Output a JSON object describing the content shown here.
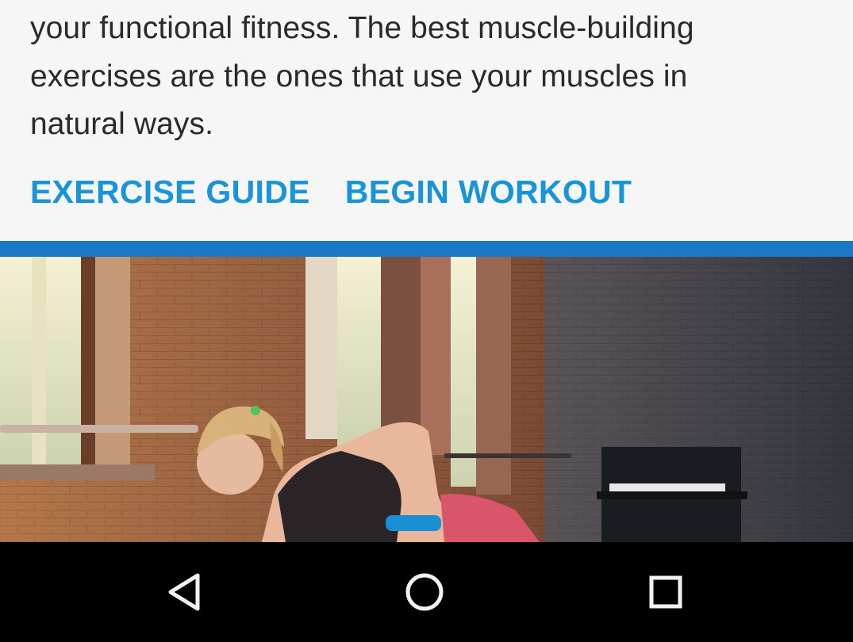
{
  "card": {
    "description_lines": [
      "your functional fitness. The best muscle-building",
      "exercises are the ones that use your muscles in",
      "natural ways."
    ],
    "actions": {
      "exercise_guide": "EXERCISE GUIDE",
      "begin_workout": "BEGIN WORKOUT"
    }
  },
  "colors": {
    "accent": "#1a94d8",
    "bar": "#1a78c9",
    "nav_background": "#000000",
    "text": "#2a2a2a"
  },
  "nav": {
    "back_icon": "back-triangle-icon",
    "home_icon": "home-circle-icon",
    "recents_icon": "recents-square-icon"
  }
}
